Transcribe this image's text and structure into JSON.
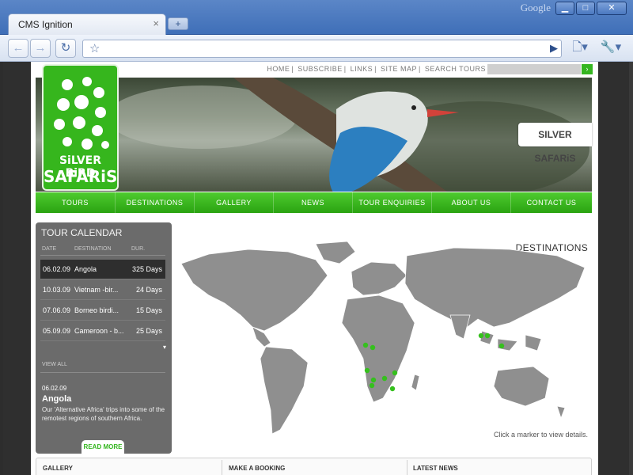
{
  "browser": {
    "brand": "Google",
    "tab_title": "CMS Ignition",
    "new_tab_icon": "plus-icon",
    "window_buttons": [
      "minimize",
      "maximize",
      "close"
    ]
  },
  "site": {
    "top_links": [
      "HOME",
      "SUBSCRIBE",
      "LINKS",
      "SITE MAP",
      "SEARCH TOURS"
    ],
    "logo_line1": "SiLVER BiRD",
    "logo_line2": "SAFARiS",
    "hero_badge": "SILVER SAFARiS",
    "nav": [
      "TOURS",
      "DESTINATIONS",
      "GALLERY",
      "NEWS",
      "TOUR ENQUIRIES",
      "ABOUT US",
      "CONTACT US"
    ],
    "accent_color": "#35b620"
  },
  "calendar": {
    "title": "TOUR CALENDAR",
    "headers": [
      "DATE",
      "DESTINATION",
      "DUR."
    ],
    "rows": [
      {
        "date": "06.02.09",
        "name": "Angola",
        "dur": "325 Days"
      },
      {
        "date": "10.03.09",
        "name": "Vietnam -bir...",
        "dur": "24 Days"
      },
      {
        "date": "07.06.09",
        "name": "Borneo birdi...",
        "dur": "15 Days"
      },
      {
        "date": "05.09.09",
        "name": "Cameroon - b...",
        "dur": "25 Days"
      }
    ],
    "view_all": "VIEW ALL",
    "featured_date": "06.02.09",
    "featured_place": "Angola",
    "featured_desc": "Our 'Alternative Africa' trips into some of the remotest regions of southern Africa.",
    "read_more": "READ MORE"
  },
  "map": {
    "title": "DESTINATIONS",
    "hint": "Click a marker to view details."
  },
  "bottom": {
    "gallery": "GALLERY",
    "booking": "MAKE A BOOKING",
    "news": "LATEST NEWS"
  }
}
